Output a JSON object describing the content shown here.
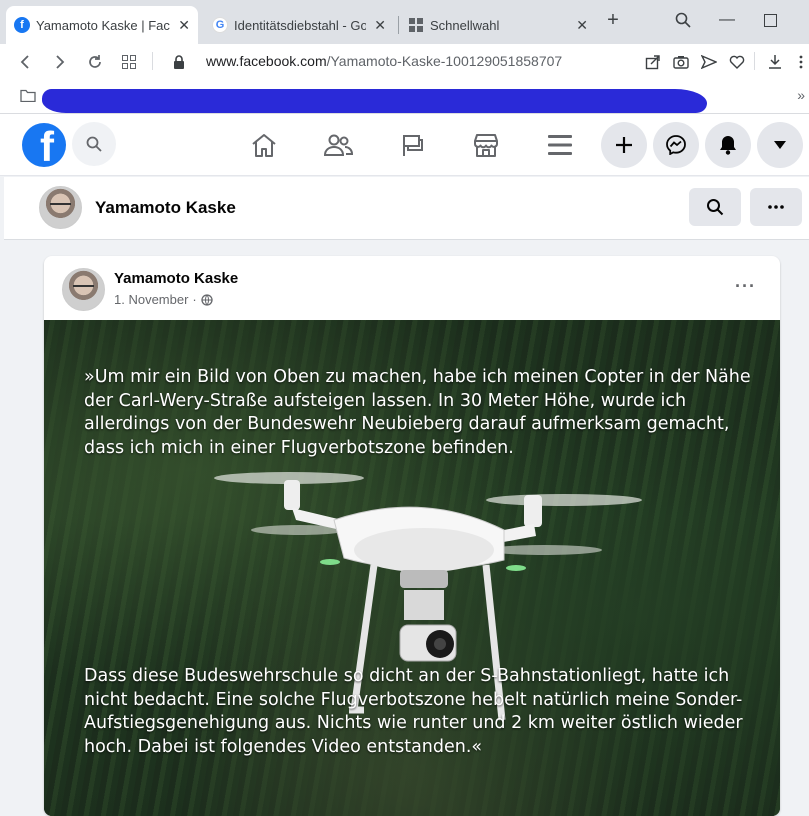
{
  "browser": {
    "tabs": [
      {
        "title": "Yamamoto Kaske | Faceb",
        "active": true
      },
      {
        "title": "Identitätsdiebstahl - Go",
        "active": false
      },
      {
        "title": "Schnellwahl",
        "active": false
      }
    ],
    "url_host": "www.facebook.com",
    "url_path": "/Yamamoto-Kaske-100129051858707"
  },
  "colors": {
    "fb_blue": "#1877f2",
    "redaction": "#2a2ad8"
  },
  "page": {
    "name": "Yamamoto Kaske"
  },
  "post": {
    "author": "Yamamoto Kaske",
    "date": "1. November",
    "date_sep": "·",
    "image_text_top": "»Um mir ein Bild von Oben zu machen, habe ich meinen Copter in der Nähe der Carl-Wery-Straße aufsteigen lassen. In 30 Meter Höhe, wurde ich allerdings von der Bundeswehr Neubieberg darauf aufmerksam gemacht, dass ich mich in einer Flugverbotszone befinden.",
    "image_text_bottom": "Dass diese Budeswehrschule so dicht an der S-Bahnstationliegt, hatte ich nicht bedacht. Eine solche Flugverbotszone hebelt natürlich meine Sonder-Aufstiegsgenehigung aus. Nichts wie runter und 2 km weiter östlich wieder hoch. Dabei ist folgendes Video entstanden.«"
  },
  "icons": [
    "facebook-logo-icon",
    "search-icon",
    "home-icon",
    "friends-icon",
    "flag-icon",
    "marketplace-icon",
    "menu-icon",
    "plus-icon",
    "messenger-icon",
    "bell-icon",
    "caret-down-icon",
    "more-icon",
    "globe-icon"
  ]
}
